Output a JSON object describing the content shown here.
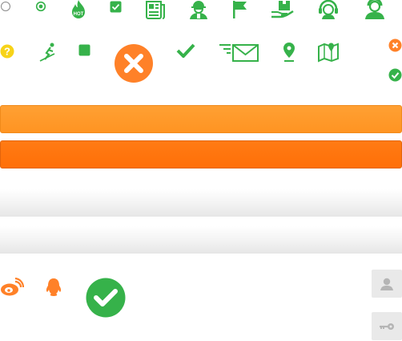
{
  "colors": {
    "green": "#36b24a",
    "orange_light": "#ff9a2b",
    "orange_dark": "#ff7310",
    "error_orange": "#ff8128",
    "icon_gray": "#b5b5b5",
    "help_yellow": "#f7d318"
  },
  "icons_row1": [
    "radio-unchecked-icon",
    "radio-checked-icon",
    "hot-fire-icon",
    "checkbox-checked-icon",
    "newspaper-icon",
    "worker-icon",
    "flag-icon",
    "box-in-hand-icon",
    "customer-service-icon",
    "users-icon"
  ],
  "icons_row2": [
    "help-icon",
    "skiing-icon",
    "square-icon",
    "error-circle-icon",
    "checkmark-icon",
    "mail-send-icon",
    "location-pin-icon",
    "map-icon",
    "close-circle-icon",
    "check-circle-icon"
  ],
  "icons_row3": [
    "weibo-icon",
    "qq-icon",
    "check-circle-large-icon",
    "user-icon",
    "key-icon"
  ],
  "hot_badge": "HOT",
  "help_glyph": "?"
}
